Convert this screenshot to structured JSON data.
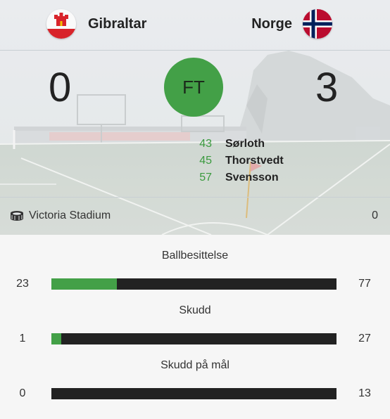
{
  "home_team": {
    "name": "Gibraltar",
    "score": "0",
    "flag_icon": "gibraltar-flag-icon"
  },
  "away_team": {
    "name": "Norge",
    "score": "3",
    "flag_icon": "norway-flag-icon"
  },
  "match_status": "FT",
  "goals": [
    {
      "minute": "43",
      "player": "Sørloth"
    },
    {
      "minute": "45",
      "player": "Thorstvedt"
    },
    {
      "minute": "57",
      "player": "Svensson"
    }
  ],
  "venue": {
    "icon": "stadium-icon",
    "name": "Victoria Stadium",
    "attendance": "0"
  },
  "stats": [
    {
      "label": "Ballbesittelse",
      "home": "23",
      "away": "77",
      "home_share": 0.23
    },
    {
      "label": "Skudd",
      "home": "1",
      "away": "27",
      "home_share": 0.035
    },
    {
      "label": "Skudd på mål",
      "home": "0",
      "away": "13",
      "home_share": 0
    }
  ],
  "colors": {
    "accent": "#43a047",
    "bar_dark": "#222222"
  }
}
